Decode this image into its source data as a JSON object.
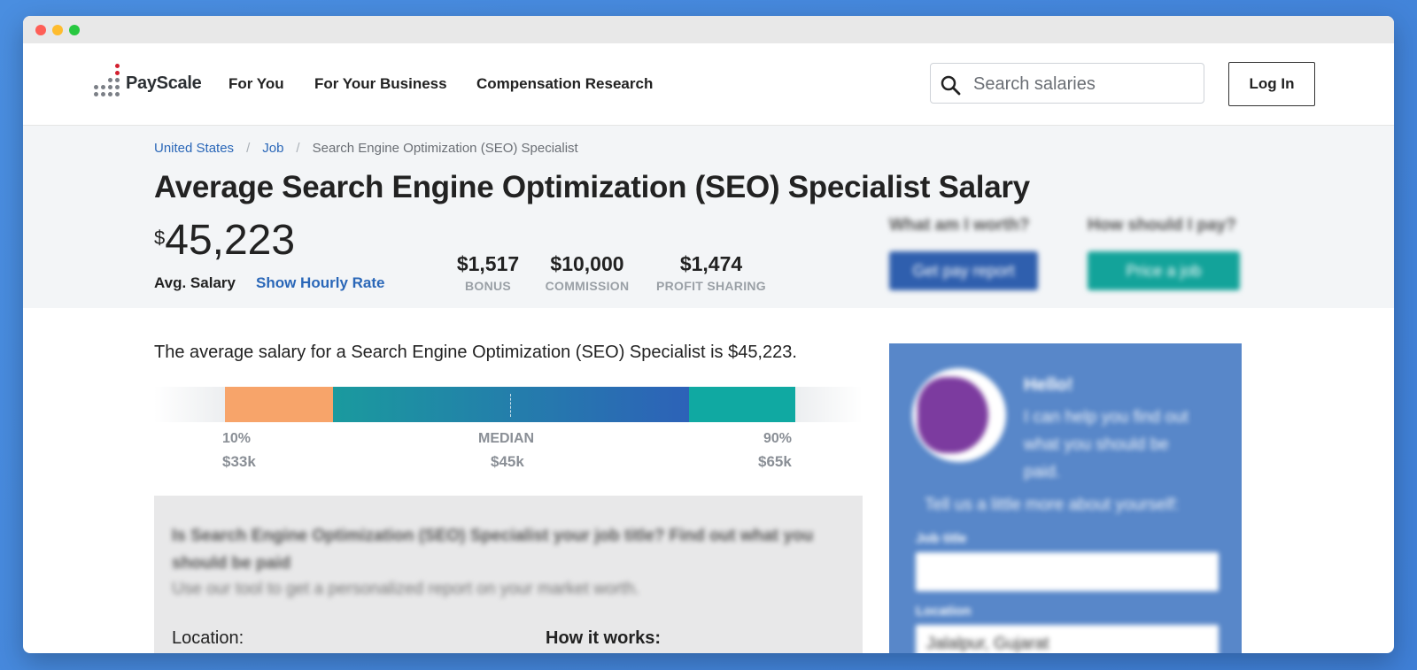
{
  "brand": {
    "name": "PayScale"
  },
  "nav": {
    "links": [
      "For You",
      "For Your Business",
      "Compensation Research"
    ]
  },
  "search": {
    "placeholder": "Search salaries"
  },
  "login": {
    "label": "Log In"
  },
  "breadcrumb": {
    "items": [
      "United States",
      "Job",
      "Search Engine Optimization (SEO) Specialist"
    ]
  },
  "page": {
    "title": "Average Search Engine Optimization (SEO) Specialist Salary"
  },
  "salary": {
    "currency": "$",
    "amount": "45,223",
    "label": "Avg. Salary",
    "hourly_link": "Show Hourly Rate",
    "stats": [
      {
        "value": "$1,517",
        "label": "BONUS"
      },
      {
        "value": "$10,000",
        "label": "COMMISSION"
      },
      {
        "value": "$1,474",
        "label": "PROFIT SHARING"
      }
    ]
  },
  "cta": {
    "q1": "What am I worth?",
    "b1": "Get pay report",
    "q2": "How should I pay?",
    "b2": "Price a job"
  },
  "summary": {
    "text": "The average salary for a Search Engine Optimization (SEO) Specialist is $45,223."
  },
  "distribution": {
    "p10_label": "10%",
    "p10_value": "$33k",
    "median_label": "MEDIAN",
    "median_value": "$45k",
    "p90_label": "90%",
    "p90_value": "$65k",
    "colors": {
      "low": "#f7a46a",
      "mid_start": "#1a9a9e",
      "mid_end": "#2d62b8",
      "high": "#10a9a2"
    }
  },
  "survey": {
    "headline": "Is Search Engine Optimization (SEO) Specialist your job title? Find out what you should be paid",
    "subline": "Use our tool to get a personalized report on your market worth.",
    "location_label": "Location:",
    "how_label": "How it works:"
  },
  "side": {
    "greeting": "Hello!",
    "message": "I can help you find out what you should be paid.",
    "tell": "Tell us a little more about yourself:",
    "job_label": "Job title",
    "location_label": "Location",
    "location_value": "Jalalpur, Gujarat"
  }
}
